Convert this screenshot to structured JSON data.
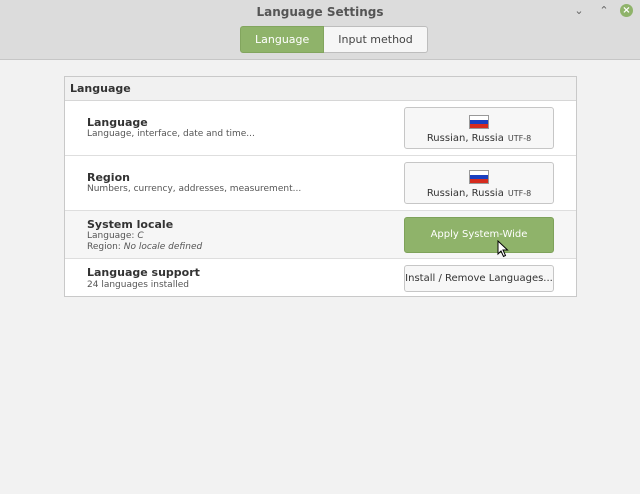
{
  "window": {
    "title": "Language Settings"
  },
  "tabs": [
    {
      "label": "Language"
    },
    {
      "label": "Input method"
    }
  ],
  "panel": {
    "header": "Language",
    "rows": [
      {
        "title": "Language",
        "subtitle": "Language, interface, date and time...",
        "button": {
          "label": "Russian, Russia",
          "encoding": "UTF-8"
        }
      },
      {
        "title": "Region",
        "subtitle": "Numbers, currency, addresses, measurement...",
        "button": {
          "label": "Russian, Russia",
          "encoding": "UTF-8"
        }
      },
      {
        "title": "System locale",
        "line1_label": "Language:",
        "line1_value": "C",
        "line2_label": "Region:",
        "line2_value": "No locale defined",
        "button": {
          "label": "Apply System-Wide"
        }
      },
      {
        "title": "Language support",
        "subtitle": "24 languages installed",
        "button": {
          "label": "Install / Remove Languages..."
        }
      }
    ]
  },
  "colors": {
    "accent": "#8fb36a"
  }
}
